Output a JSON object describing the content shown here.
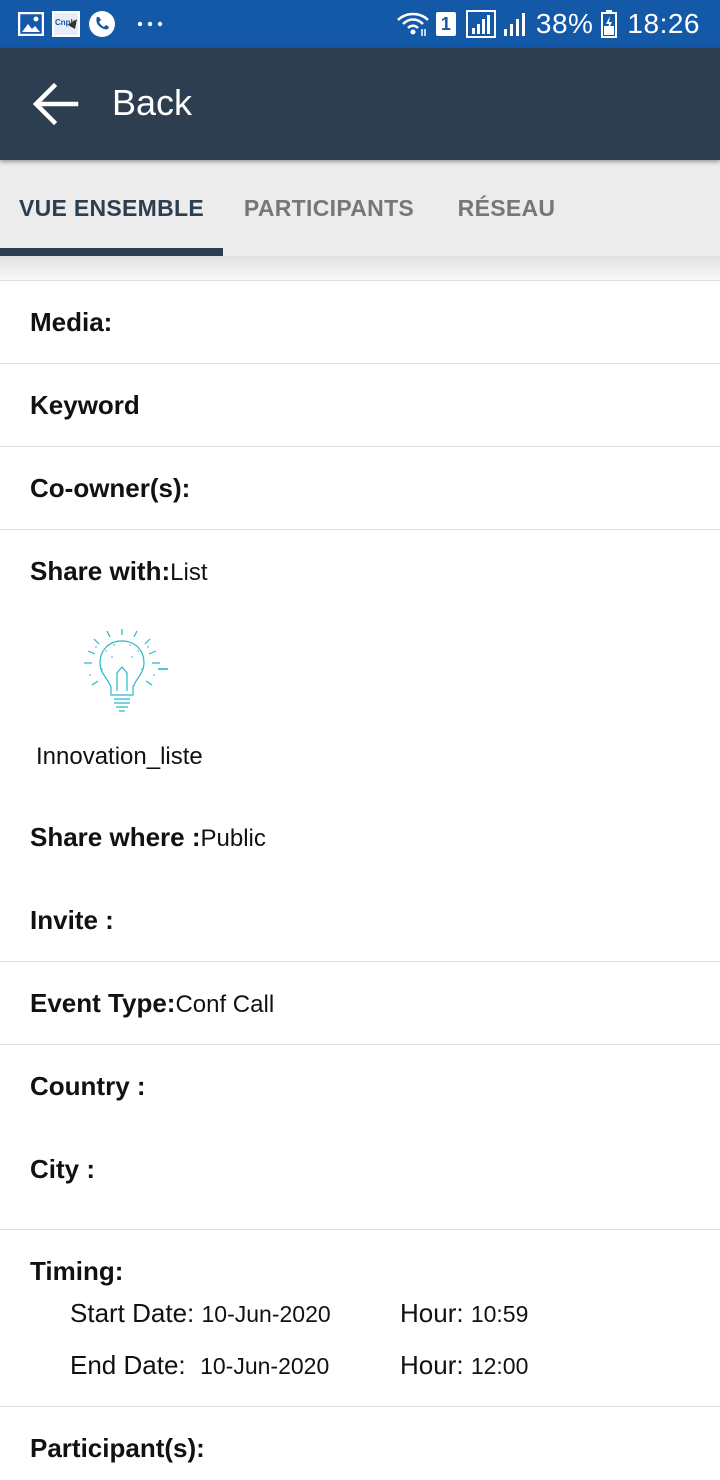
{
  "status_bar": {
    "battery": "38%",
    "time": "18:26",
    "sim": "1",
    "icons": [
      "gallery-icon",
      "app-notification-icon",
      "phone-icon",
      "more-dots-icon",
      "wifi-icon",
      "sim-icon",
      "signal-icon",
      "signal-bars-icon",
      "battery-icon"
    ]
  },
  "appbar": {
    "back_label": "Back",
    "icon": "arrow-left-icon"
  },
  "tabs": [
    {
      "label": "VUE ENSEMBLE",
      "active": true
    },
    {
      "label": "PARTICIPANTS",
      "active": false
    },
    {
      "label": "RÉSEAU",
      "active": false
    }
  ],
  "details": {
    "media_label": "Media:",
    "keyword_label": "Keyword",
    "coowners_label": "Co-owner(s):",
    "share_with_label": "Share with:",
    "share_with_value": "List",
    "list_item_name": "Innovation_liste",
    "list_item_icon": "lightbulb-icon",
    "share_where_label": "Share where :",
    "share_where_value": "Public",
    "invite_label": "Invite :",
    "event_type_label": "Event Type:",
    "event_type_value": "Conf Call",
    "country_label": "Country :",
    "city_label": "City :",
    "timing_label": "Timing:",
    "start_date_label": "Start Date:",
    "start_date_value": "10-Jun-2020",
    "start_hour_label": "Hour:",
    "start_hour_value": "10:59",
    "end_date_label": "End Date:",
    "end_date_value": "10-Jun-2020",
    "end_hour_label": "Hour:",
    "end_hour_value": "12:00",
    "participants_label": "Participant(s):"
  },
  "colors": {
    "status_bar": "#1458a8",
    "app_bar": "#2d3e50",
    "tab_active": "#2d3e50",
    "tab_inactive": "#777777",
    "bulb": "#27b9c6"
  }
}
